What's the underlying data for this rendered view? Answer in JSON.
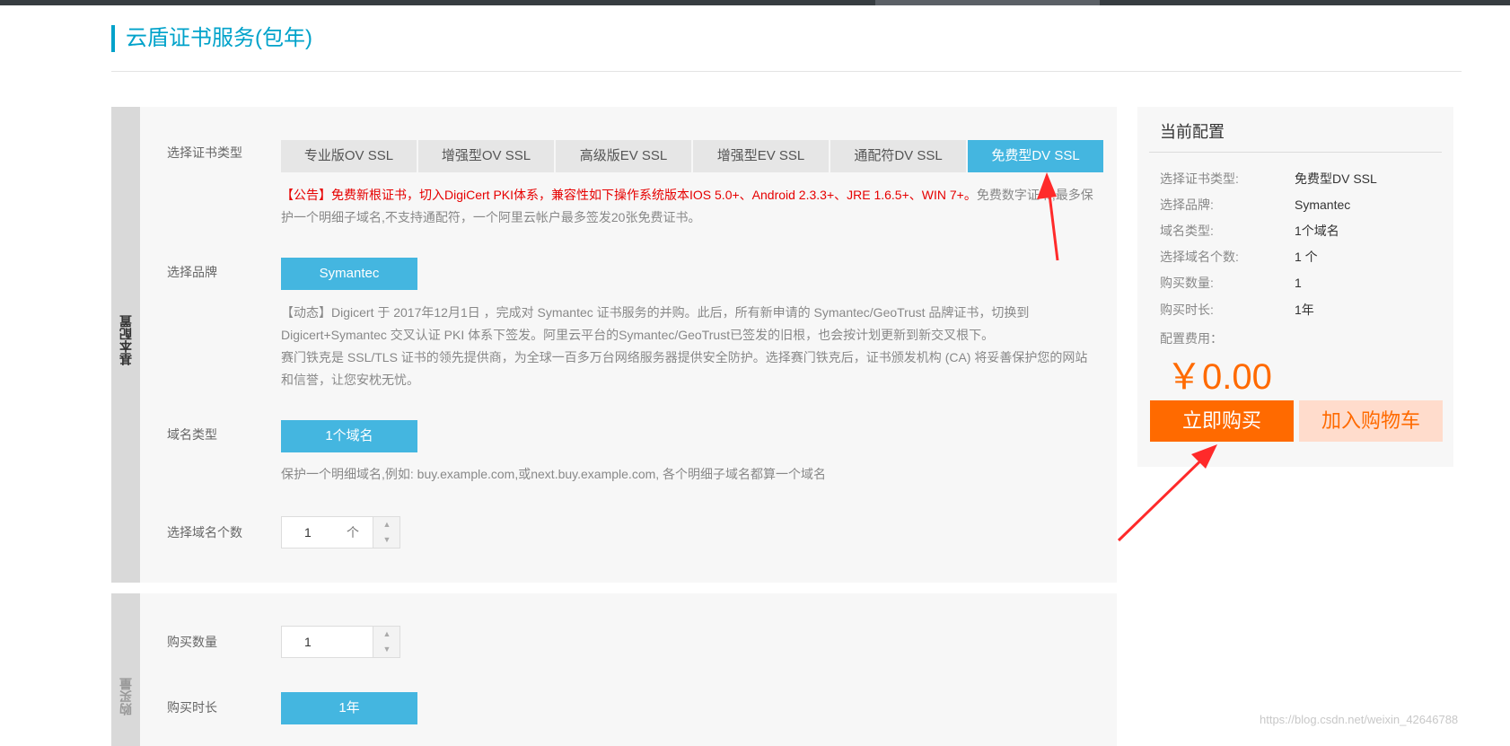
{
  "page_title": "云盾证书服务(包年)",
  "basic_section": {
    "side_label": "基本配置",
    "cert_type_label": "选择证书类型",
    "cert_types": [
      "专业版OV SSL",
      "增强型OV SSL",
      "高级版EV SSL",
      "增强型EV SSL",
      "通配符DV SSL",
      "免费型DV SSL"
    ],
    "selected_cert_type": "免费型DV SSL",
    "notice_red": "【公告】免费新根证书，切入DigiCert PKI体系，兼容性如下操作系统版本IOS 5.0+、Android 2.3.3+、JRE 1.6.5+、WIN 7+。",
    "notice_gray": "免费数字证书,最多保护一个明细子域名,不支持通配符，一个阿里云帐户最多签发20张免费证书。",
    "brand_label": "选择品牌",
    "brand_option": "Symantec",
    "brand_desc_1": "【动态】Digicert 于 2017年12月1日 ，完成对 Symantec 证书服务的并购。此后，所有新申请的 Symantec/GeoTrust 品牌证书，切换到 Digicert+Symantec 交叉认证 PKI 体系下签发。阿里云平台的Symantec/GeoTrust已签发的旧根，也会按计划更新到新交叉根下。",
    "brand_desc_2": "赛门铁克是 SSL/TLS 证书的领先提供商，为全球一百多万台网络服务器提供安全防护。选择赛门铁克后，证书颁发机构 (CA) 将妥善保护您的网站和信誉，让您安枕无忧。",
    "domain_type_label": "域名类型",
    "domain_type_option": "1个域名",
    "domain_type_desc": "保护一个明细域名,例如: buy.example.com,或next.buy.example.com, 各个明细子域名都算一个域名",
    "domain_count_label": "选择域名个数",
    "domain_count_value": "1",
    "domain_count_unit": "个"
  },
  "quantity_section": {
    "side_label": "购买量",
    "qty_label": "购买数量",
    "qty_value": "1",
    "duration_label": "购买时长",
    "duration_option": "1年"
  },
  "summary": {
    "title": "当前配置",
    "rows": [
      {
        "k": "选择证书类型:",
        "v": "免费型DV SSL"
      },
      {
        "k": "选择品牌:",
        "v": "Symantec"
      },
      {
        "k": "域名类型:",
        "v": "1个域名"
      },
      {
        "k": "选择域名个数:",
        "v": "1 个"
      },
      {
        "k": "购买数量:",
        "v": "1"
      },
      {
        "k": "购买时长:",
        "v": "1年"
      }
    ],
    "fee_label": "配置费用：",
    "price": "￥0.00",
    "buy_button": "立即购买",
    "cart_button": "加入购物车"
  },
  "spinner_glyphs": {
    "up": "▲",
    "down": "▼"
  },
  "annotation_color": "#ff2a2a",
  "accent_color": "#44b6e0",
  "buy_color": "#ff6a00",
  "watermark": "https://blog.csdn.net/weixin_42646788"
}
